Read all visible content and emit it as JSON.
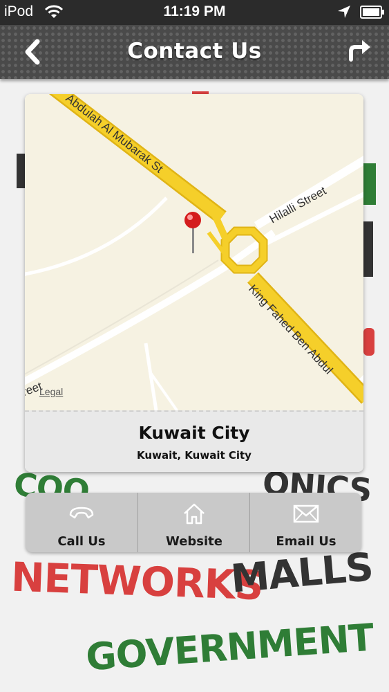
{
  "status_bar": {
    "carrier": "iPod",
    "time": "11:19 PM"
  },
  "nav": {
    "title": "Contact Us"
  },
  "map": {
    "street_labels": [
      "Abdulah Al Mubarak St",
      "Hilalli Street",
      "King Fahed Ben Abdul",
      "treet"
    ],
    "legal": "Legal"
  },
  "location": {
    "name": "Kuwait City",
    "address": "Kuwait, Kuwait City"
  },
  "actions": [
    {
      "label": "Call Us",
      "icon": "phone-icon"
    },
    {
      "label": "Website",
      "icon": "home-icon"
    },
    {
      "label": "Email Us",
      "icon": "envelope-icon"
    }
  ],
  "background_words": [
    "NETWORKS",
    "MALLS",
    "GOVERNMENT",
    "COO",
    "ONICS"
  ],
  "colors": {
    "nav_bg": "#4a4a4a",
    "road_yellow": "#f5cf2a",
    "map_bg": "#f6f2e2",
    "red_word": "#d8403f",
    "green_word": "#2f7d36"
  }
}
